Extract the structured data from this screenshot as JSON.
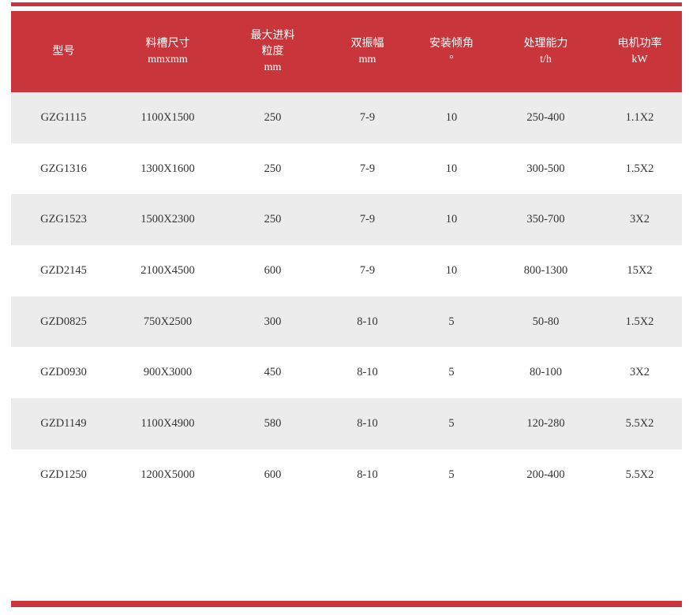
{
  "table": {
    "headers": [
      [
        "型号"
      ],
      [
        "料槽尺寸",
        "mmxmm"
      ],
      [
        "最大进料",
        "粒度",
        "mm"
      ],
      [
        "双振幅",
        "mm"
      ],
      [
        "安装倾角",
        "°"
      ],
      [
        "处理能力",
        "t/h"
      ],
      [
        "电机功率",
        "kW"
      ]
    ],
    "rows": [
      [
        "GZG1115",
        "1100X1500",
        "250",
        "7-9",
        "10",
        "250-400",
        "1.1X2"
      ],
      [
        "GZG1316",
        "1300X1600",
        "250",
        "7-9",
        "10",
        "300-500",
        "1.5X2"
      ],
      [
        "GZG1523",
        "1500X2300",
        "250",
        "7-9",
        "10",
        "350-700",
        "3X2"
      ],
      [
        "GZD2145",
        "2100X4500",
        "600",
        "7-9",
        "10",
        "800-1300",
        "15X2"
      ],
      [
        "GZD0825",
        "750X2500",
        "300",
        "8-10",
        "5",
        "50-80",
        "1.5X2"
      ],
      [
        "GZD0930",
        "900X3000",
        "450",
        "8-10",
        "5",
        "80-100",
        "3X2"
      ],
      [
        "GZD1149",
        "1100X4900",
        "580",
        "8-10",
        "5",
        "120-280",
        "5.5X2"
      ],
      [
        "GZD1250",
        "1200X5000",
        "600",
        "8-10",
        "5",
        "200-400",
        "5.5X2"
      ]
    ]
  },
  "colors": {
    "header_background": "#c8363c",
    "stripe": "#ececec"
  }
}
